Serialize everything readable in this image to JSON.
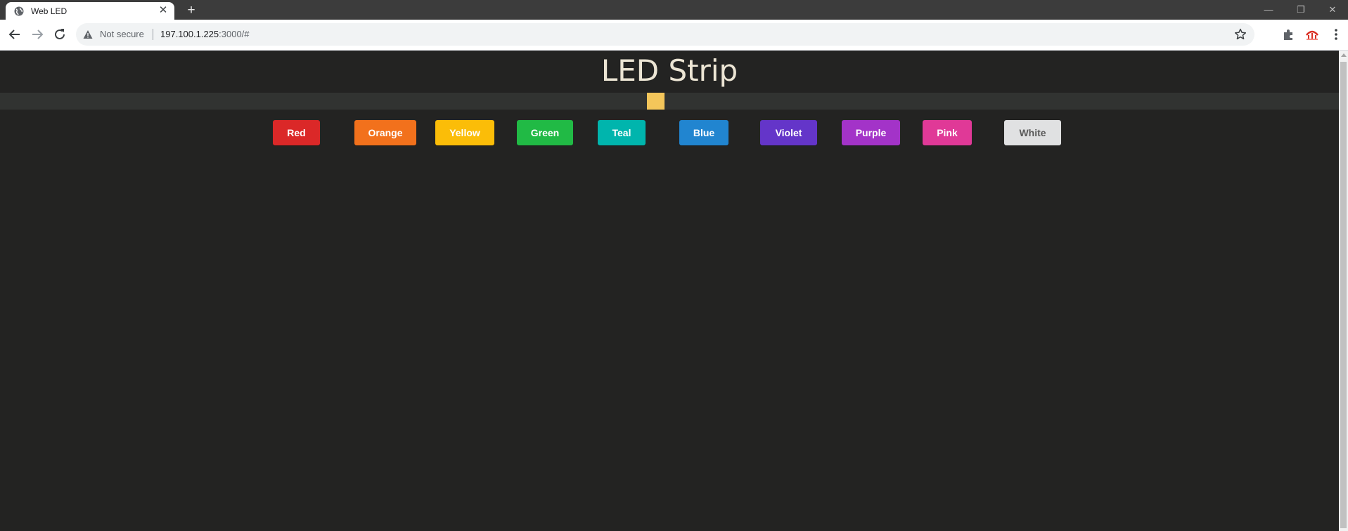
{
  "browser": {
    "tab": {
      "title": "Web LED",
      "close_glyph": "✕"
    },
    "new_tab_glyph": "+",
    "window_controls": {
      "minimize_glyph": "—",
      "restore_glyph": "❐",
      "close_glyph": "✕"
    },
    "address_bar": {
      "security_label": "Not secure",
      "url_host": "197.100.1.225",
      "url_rest": ":3000/#"
    },
    "icons": [
      "globe-icon",
      "back-arrow-icon",
      "forward-arrow-icon",
      "reload-icon",
      "warning-icon",
      "star-icon",
      "extensions-icon",
      "profile-avatar-icon",
      "kebab-menu-icon"
    ]
  },
  "page": {
    "title": "LED Strip",
    "led_color": "#f4c65a",
    "buttons": [
      {
        "label": "Red",
        "color": "#db2828",
        "text_color": "#ffffff"
      },
      {
        "label": "Orange",
        "color": "#f2711c",
        "text_color": "#ffffff"
      },
      {
        "label": "Yellow",
        "color": "#fbbd08",
        "text_color": "#ffffff"
      },
      {
        "label": "Green",
        "color": "#21ba45",
        "text_color": "#ffffff"
      },
      {
        "label": "Teal",
        "color": "#00b5ad",
        "text_color": "#ffffff"
      },
      {
        "label": "Blue",
        "color": "#2185d0",
        "text_color": "#ffffff"
      },
      {
        "label": "Violet",
        "color": "#6435c9",
        "text_color": "#ffffff"
      },
      {
        "label": "Purple",
        "color": "#a333c8",
        "text_color": "#ffffff"
      },
      {
        "label": "Pink",
        "color": "#e03997",
        "text_color": "#ffffff"
      },
      {
        "label": "White",
        "color": "#e0e1e2",
        "text_color": "#5a5a5a"
      }
    ]
  }
}
